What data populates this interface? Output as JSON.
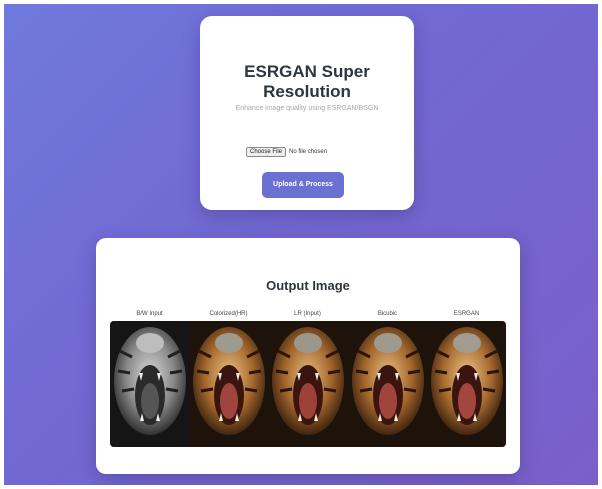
{
  "upload": {
    "title": "ESRGAN Super Resolution",
    "subtitle": "Enhance image quality using ESRGAN/BSGN",
    "choose_file_label": "Choose File",
    "no_file_text": "No file chosen",
    "submit_label": "Upload & Process"
  },
  "output": {
    "title": "Output Image",
    "images": [
      {
        "label": "B/W Input",
        "tone": "grayscale"
      },
      {
        "label": "Colorized(HR)",
        "tone": "color"
      },
      {
        "label": "LR (Input)",
        "tone": "color"
      },
      {
        "label": "Bicubic",
        "tone": "color"
      },
      {
        "label": "ESRGAN",
        "tone": "color"
      }
    ]
  },
  "colors": {
    "background_gradient_start": "#6f79dc",
    "background_gradient_end": "#7a5fc8",
    "button": "#6a71d0"
  }
}
